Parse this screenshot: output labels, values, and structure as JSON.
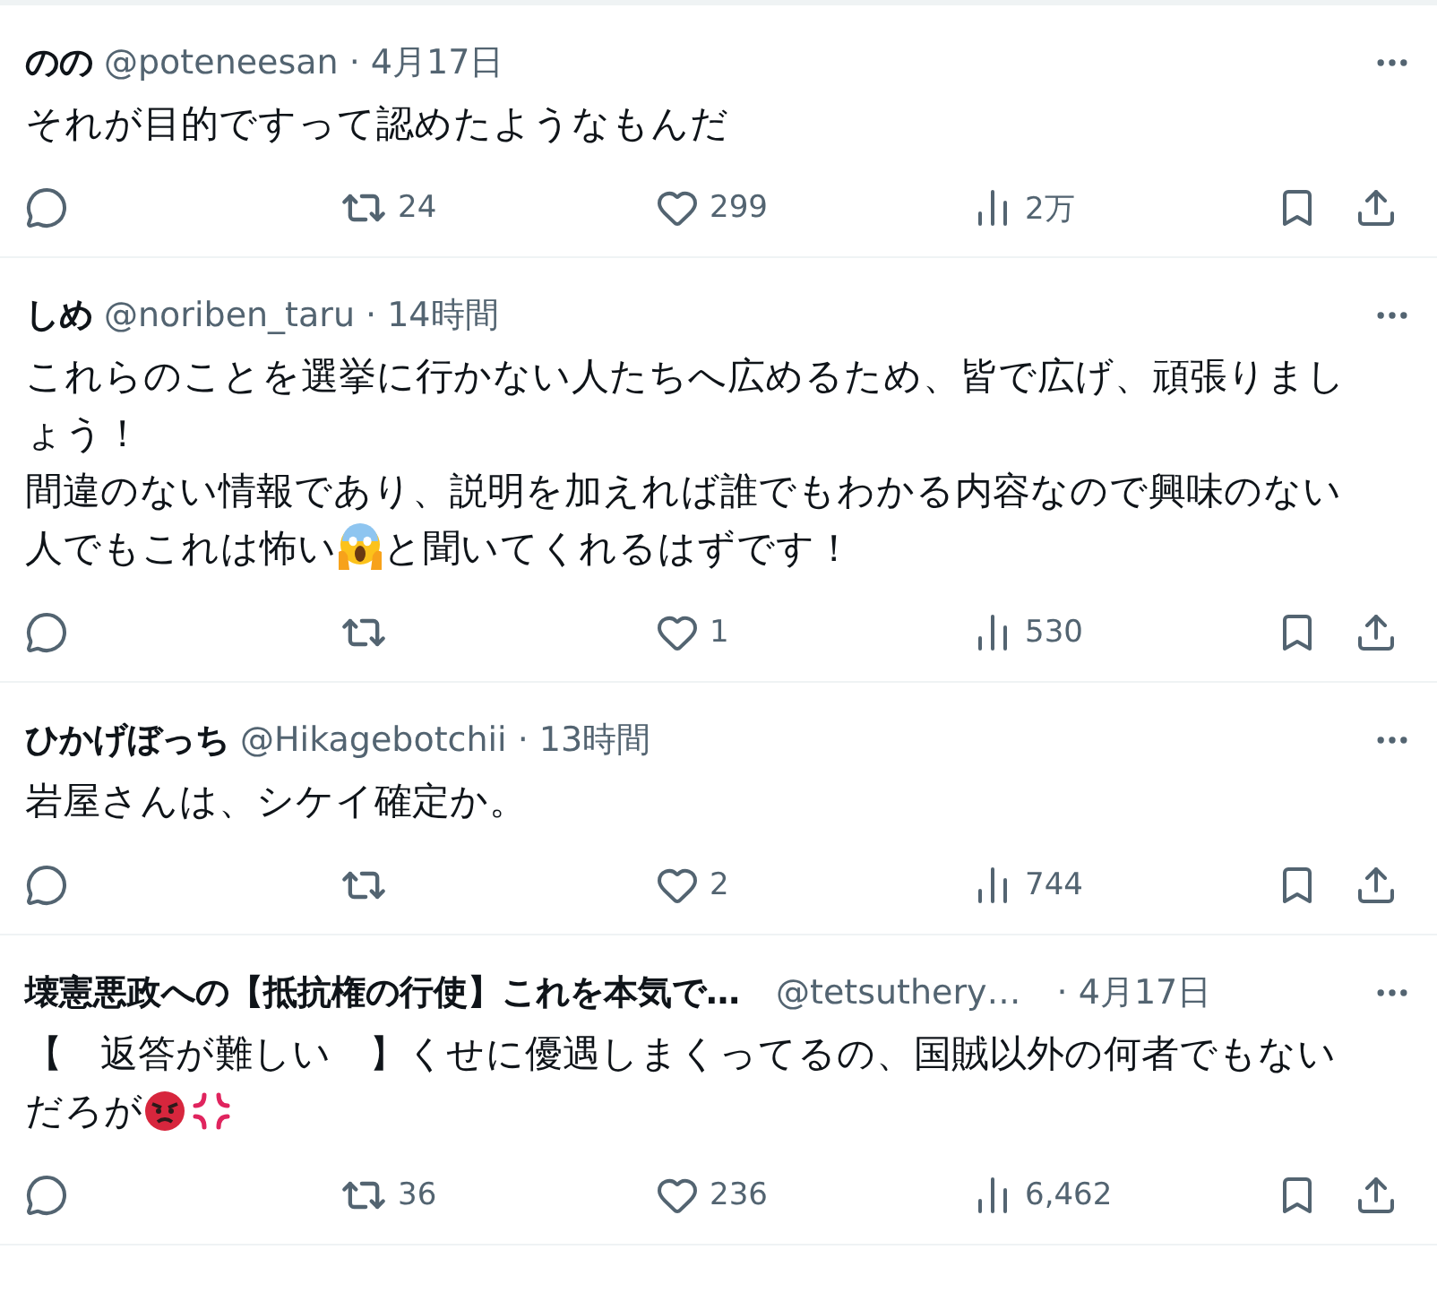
{
  "tweets": [
    {
      "name": "のの",
      "handle": "@poteneesan",
      "time": "· 4月17日",
      "body": [
        [
          {
            "kind": "text",
            "text": "それが目的ですって認めたようなもんだ"
          }
        ]
      ],
      "retweets": "24",
      "likes": "299",
      "views": "2万"
    },
    {
      "name": "しめ",
      "handle": "@noriben_taru",
      "time": "· 14時間",
      "body": [
        [
          {
            "kind": "text",
            "text": "これらのことを選挙に行かない人たちへ広めるため、皆で広げ、頑張りまし"
          }
        ],
        [
          {
            "kind": "text",
            "text": "ょう！"
          }
        ],
        [
          {
            "kind": "text",
            "text": "間違のない情報であり、説明を加えれば誰でもわかる内容なので興味のない"
          }
        ],
        [
          {
            "kind": "text",
            "text": "人でもこれは怖い"
          },
          {
            "kind": "scream"
          },
          {
            "kind": "text",
            "text": "と聞いてくれるはずです！"
          }
        ]
      ],
      "likes": "1",
      "views": "530"
    },
    {
      "name": "ひかげぼっち",
      "handle": "@Hikagebotchii",
      "time": "· 13時間",
      "body": [
        [
          {
            "kind": "text",
            "text": "岩屋さんは、シケイ確定か。"
          }
        ]
      ],
      "likes": "2",
      "views": "744"
    },
    {
      "name": "壊憲悪政への【抵抗権の行使】これを本気で…",
      "handle": "@tetsuthery…",
      "time": "· 4月17日",
      "body": [
        [
          {
            "kind": "text",
            "text": "【　返答が難しい　】くせに優遇しまくってるの、国賊以外の何者でもない"
          }
        ],
        [
          {
            "kind": "text",
            "text": "だろが"
          },
          {
            "kind": "angry"
          },
          {
            "kind": "anger"
          }
        ]
      ],
      "retweets": "36",
      "likes": "236",
      "views": "6,462"
    }
  ]
}
